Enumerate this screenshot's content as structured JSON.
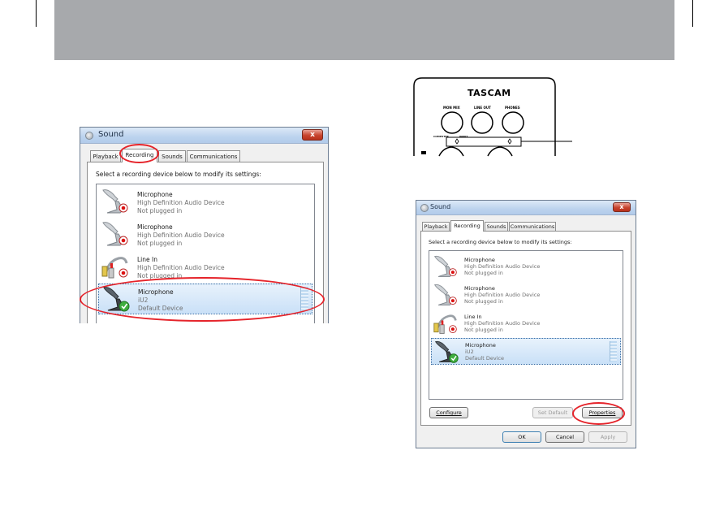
{
  "device_panel": {
    "brand": "TASCAM",
    "knob_labels": [
      "MON MIX",
      "LINE OUT",
      "PHONES"
    ],
    "small_labels": [
      "COMPUTER",
      "INPUT"
    ]
  },
  "dialog_left": {
    "title": "Sound",
    "close_glyph": "x",
    "tabs": [
      "Playback",
      "Recording",
      "Sounds",
      "Communications"
    ],
    "active_tab": "Recording",
    "instruction": "Select a recording device below to modify its settings:",
    "devices": [
      {
        "name": "Microphone",
        "detail": "High Definition Audio Device",
        "status": "Not plugged in",
        "icon": "microphone-unplugged-icon"
      },
      {
        "name": "Microphone",
        "detail": "High Definition Audio Device",
        "status": "Not plugged in",
        "icon": "microphone-unplugged-icon"
      },
      {
        "name": "Line In",
        "detail": "High Definition Audio Device",
        "status": "Not plugged in",
        "icon": "line-in-cable-icon"
      },
      {
        "name": "Microphone",
        "detail": "iU2",
        "status": "Default Device",
        "icon": "microphone-default-icon",
        "selected": true
      }
    ]
  },
  "dialog_right": {
    "title": "Sound",
    "close_glyph": "x",
    "tabs": [
      "Playback",
      "Recording",
      "Sounds",
      "Communications"
    ],
    "active_tab": "Recording",
    "instruction": "Select a recording device below to modify its settings:",
    "devices": [
      {
        "name": "Microphone",
        "detail": "High Definition Audio Device",
        "status": "Not plugged in",
        "icon": "microphone-unplugged-icon"
      },
      {
        "name": "Microphone",
        "detail": "High Definition Audio Device",
        "status": "Not plugged in",
        "icon": "microphone-unplugged-icon"
      },
      {
        "name": "Line In",
        "detail": "High Definition Audio Device",
        "status": "Not plugged in",
        "icon": "line-in-cable-icon"
      },
      {
        "name": "Microphone",
        "detail": "iU2",
        "status": "Default Device",
        "icon": "microphone-default-icon",
        "selected": true
      }
    ],
    "buttons": {
      "configure": "Configure",
      "set_default": "Set Default",
      "properties": "Properties",
      "ok": "OK",
      "cancel": "Cancel",
      "apply": "Apply"
    }
  },
  "colors": {
    "header_band": "#a7a9ac",
    "highlight_ellipse": "#e5242b",
    "selection": "#c9e0f7",
    "default_check": "#2e9a2e"
  }
}
